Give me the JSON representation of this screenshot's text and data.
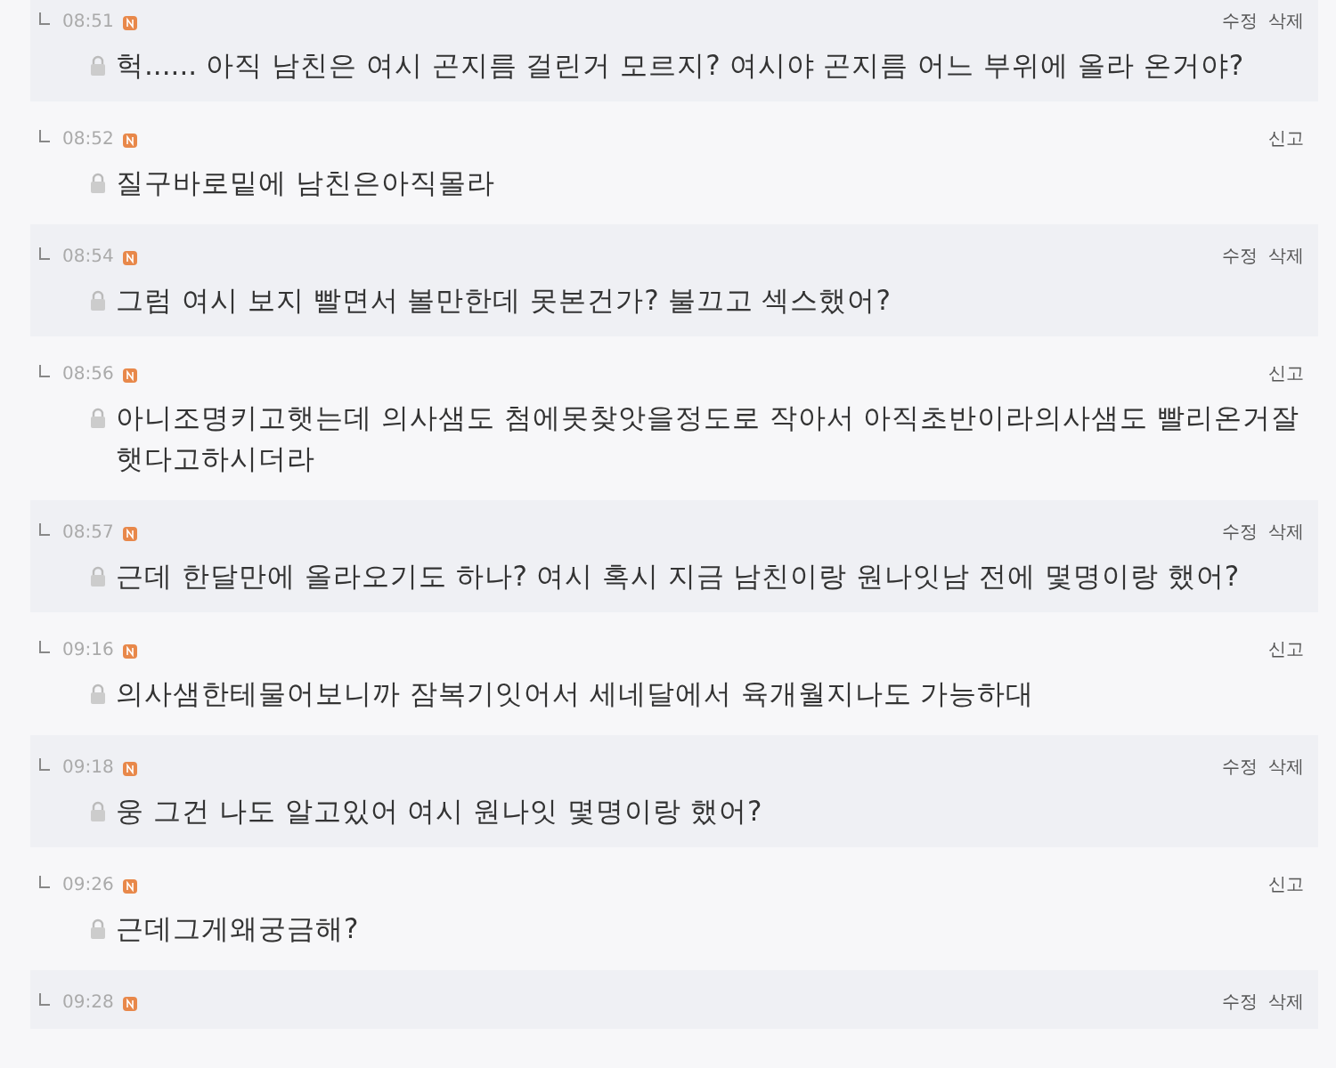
{
  "comments": [
    {
      "kind": "mine",
      "time": "08:51",
      "text": "헉...... 아직 남친은 여시 곤지름 걸린거 모르지? 여시야 곤지름 어느 부위에 올라 온거야?",
      "actions": [
        "수정",
        "삭제"
      ]
    },
    {
      "kind": "other",
      "time": "08:52",
      "text": "질구바로밑에 남친은아직몰라",
      "actions": [
        "신고"
      ]
    },
    {
      "kind": "mine",
      "time": "08:54",
      "text": "그럼 여시 보지 빨면서 볼만한데 못본건가? 불끄고 섹스했어?",
      "actions": [
        "수정",
        "삭제"
      ]
    },
    {
      "kind": "other",
      "time": "08:56",
      "text": "아니조명키고햇는데 의사샘도 첨에못찾앗을정도로 작아서 아직초반이라의사샘도 빨리온거잘햇다고하시더라",
      "actions": [
        "신고"
      ]
    },
    {
      "kind": "mine",
      "time": "08:57",
      "text": "근데 한달만에 올라오기도 하나? 여시 혹시 지금 남친이랑 원나잇남 전에 몇명이랑 했어?",
      "actions": [
        "수정",
        "삭제"
      ]
    },
    {
      "kind": "other",
      "time": "09:16",
      "text": "의사샘한테물어보니까 잠복기잇어서 세네달에서 육개월지나도 가능하대",
      "actions": [
        "신고"
      ]
    },
    {
      "kind": "mine",
      "time": "09:18",
      "text": "웅 그건 나도 알고있어 여시 원나잇 몇명이랑 했어?",
      "actions": [
        "수정",
        "삭제"
      ]
    },
    {
      "kind": "other",
      "time": "09:26",
      "text": "근데그게왜궁금해?",
      "actions": [
        "신고"
      ]
    },
    {
      "kind": "mine",
      "time": "09:28",
      "actions": [
        "수정",
        "삭제"
      ]
    }
  ]
}
